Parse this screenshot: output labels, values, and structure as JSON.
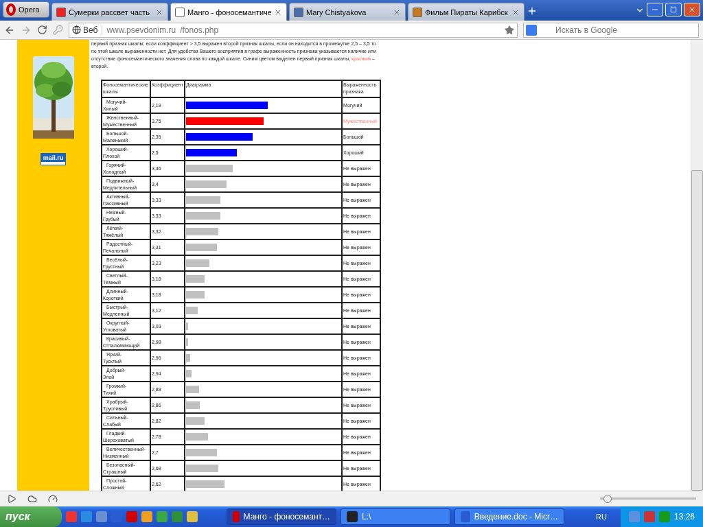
{
  "browser": {
    "menu_button": "Opera",
    "tabs": [
      {
        "title": "Сумерки рассвет часть",
        "selected": false,
        "kind": "yandex"
      },
      {
        "title": "Манго - фоносемантиче",
        "selected": true,
        "kind": "page"
      },
      {
        "title": "Mary Chistyakova",
        "selected": false,
        "kind": "vk"
      },
      {
        "title": "Фильм Пираты Карибск",
        "selected": false,
        "kind": "film"
      }
    ],
    "address_bar": {
      "badge": "Веб",
      "host": "www.psevdonim.ru",
      "path": "/fonos.php"
    },
    "search": {
      "placeholder": "Искать в Google"
    }
  },
  "sidebar": {
    "counter": "mail.ru"
  },
  "intro": {
    "text": "первый признак шкалы; если коэффициент > 3,5 выражен второй признак шкалы, если он находится в промежутке 2,5 – 3,5 то по этой шкале выраженности нет. Для удобства Вашего восприятия в графе выраженность признака указывается наличие или отсутствие фоносемантического значения слова по каждой шкале. Синим цветом выделен первый признак шкалы,",
    "highlight": "красным",
    "tail": "– второй."
  },
  "table": {
    "columns": [
      "Фоносемантические шкалы",
      "Коэффициент",
      "Диаграмма",
      "Выраженность признака"
    ],
    "rows": [
      {
        "scale": "Могучий-Хилый",
        "coefficient": "2,19",
        "kind": "first",
        "level": 0.53,
        "expression": "Могучий"
      },
      {
        "scale": "Женственный-Мужественный",
        "coefficient": "3,75",
        "kind": "second",
        "level": 0.5,
        "expression": "Мужественный"
      },
      {
        "scale": "Большой-Маленький",
        "coefficient": "2,35",
        "kind": "first",
        "level": 0.43,
        "expression": "Большой"
      },
      {
        "scale": "Хороший-Плохой",
        "coefficient": "2,5",
        "kind": "first",
        "level": 0.33,
        "expression": "Хороший"
      },
      {
        "scale": "Горячий-Холодный",
        "coefficient": "3,46",
        "kind": "none",
        "level": 0.3,
        "expression": "Не выражен"
      },
      {
        "scale": "Подвижный-Медлительный",
        "coefficient": "3,4",
        "kind": "none",
        "level": 0.26,
        "expression": "Не выражен"
      },
      {
        "scale": "Активный-Пассивный",
        "coefficient": "3,33",
        "kind": "none",
        "level": 0.22,
        "expression": "Не выражен"
      },
      {
        "scale": "Нежный-Грубый",
        "coefficient": "3,33",
        "kind": "none",
        "level": 0.22,
        "expression": "Не выражен"
      },
      {
        "scale": "Лёгкий-Тяжёлый",
        "coefficient": "3,32",
        "kind": "none",
        "level": 0.21,
        "expression": "Не выражен"
      },
      {
        "scale": "Радостный-Печальный",
        "coefficient": "3,31",
        "kind": "none",
        "level": 0.2,
        "expression": "Не выражен"
      },
      {
        "scale": "Весёлый-Грустный",
        "coefficient": "3,23",
        "kind": "none",
        "level": 0.15,
        "expression": "Не выражен"
      },
      {
        "scale": "Светлый-Тёмный",
        "coefficient": "3,18",
        "kind": "none",
        "level": 0.12,
        "expression": "Не выражен"
      },
      {
        "scale": "Длинный-Короткий",
        "coefficient": "3,18",
        "kind": "none",
        "level": 0.12,
        "expression": "Не выражен"
      },
      {
        "scale": "Быстрый-Медленный",
        "coefficient": "3,12",
        "kind": "none",
        "level": 0.074,
        "expression": "Не выражен"
      },
      {
        "scale": "Округлый-Угловатый",
        "coefficient": "3,03",
        "kind": "none",
        "level": 0.013,
        "expression": "Не выражен"
      },
      {
        "scale": "Красивый-Отталкивающий",
        "coefficient": "2,98",
        "kind": "none",
        "level": 0.013,
        "expression": "Не выражен"
      },
      {
        "scale": "Яркий-Тусклый",
        "coefficient": "2,96",
        "kind": "none",
        "level": 0.026,
        "expression": "Не выражен"
      },
      {
        "scale": "Добрый-Злой",
        "coefficient": "2,94",
        "kind": "none",
        "level": 0.035,
        "expression": "Не выражен"
      },
      {
        "scale": "Громкий-Тихий",
        "coefficient": "2,88",
        "kind": "none",
        "level": 0.083,
        "expression": "Не выражен"
      },
      {
        "scale": "Храбрый-Трусливый",
        "coefficient": "2,86",
        "kind": "none",
        "level": 0.09,
        "expression": "Не выражен"
      },
      {
        "scale": "Сильный-Слабый",
        "coefficient": "2,82",
        "kind": "none",
        "level": 0.12,
        "expression": "Не выражен"
      },
      {
        "scale": "Гладкий-Шероховатый",
        "coefficient": "2,78",
        "kind": "none",
        "level": 0.14,
        "expression": "Не выражен"
      },
      {
        "scale": "Величественный-Низменный",
        "coefficient": "2,7",
        "kind": "none",
        "level": 0.2,
        "expression": "Не выражен"
      },
      {
        "scale": "Безопасный-Страшный",
        "coefficient": "2,68",
        "kind": "none",
        "level": 0.21,
        "expression": "Не выражен"
      },
      {
        "scale": "Простой-Сложный",
        "coefficient": "2,62",
        "kind": "none",
        "level": 0.25,
        "expression": "Не выражен"
      }
    ]
  },
  "status_bar": {
    "zoom": {
      "level": 0.08
    }
  },
  "taskbar": {
    "start": "пуск",
    "tasks": [
      {
        "title": "Манго - фоносемант…",
        "selected": true,
        "kind": "opera"
      },
      {
        "title": "L:\\",
        "selected": false,
        "kind": "console"
      },
      {
        "title": "Введение.doc - Micr…",
        "selected": false,
        "kind": "word"
      }
    ],
    "language": "RU",
    "clock": "13:26"
  }
}
